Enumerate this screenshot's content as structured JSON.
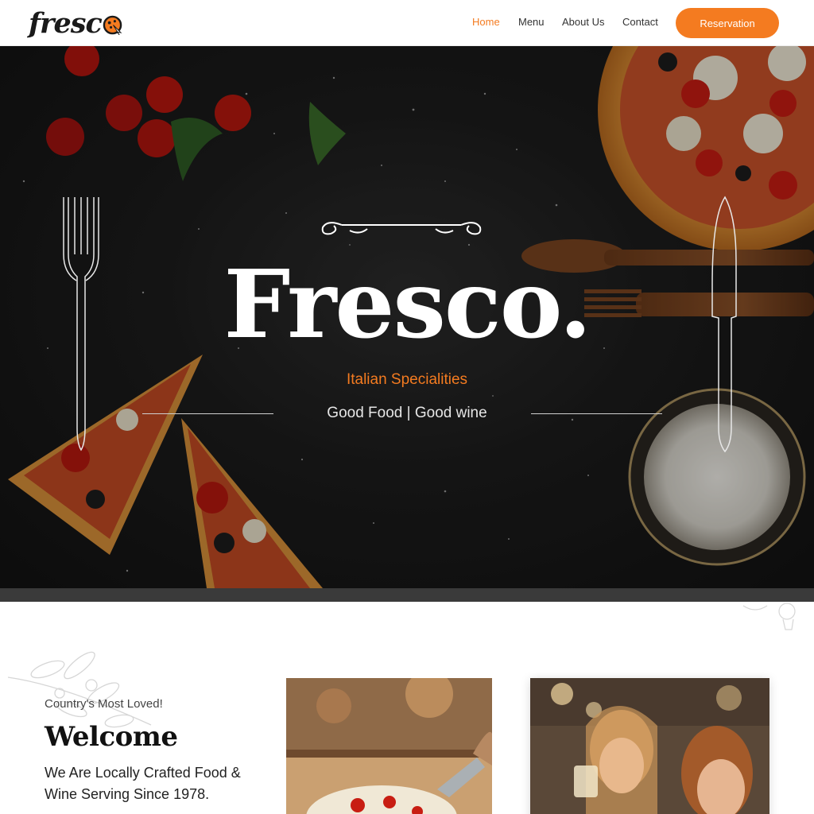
{
  "header": {
    "logo_text": "fresc",
    "nav": [
      {
        "label": "Home",
        "active": true
      },
      {
        "label": "Menu",
        "active": false
      },
      {
        "label": "About Us",
        "active": false
      },
      {
        "label": "Contact",
        "active": false
      }
    ],
    "cta_label": "Reservation"
  },
  "hero": {
    "title": "Fresco.",
    "subtitle": "Italian Specialities",
    "tagline": "Good Food | Good wine"
  },
  "welcome": {
    "kicker": "Country's Most Loved!",
    "title": "Welcome",
    "text": "We Are Locally Crafted Food & Wine Serving Since 1978."
  },
  "icons": [
    "pizza-logo-icon",
    "fork-icon",
    "knife-icon",
    "ornament-divider-icon",
    "olive-branch-icon"
  ],
  "colors": {
    "accent": "#f47b20",
    "hero_background": "#1c1c1c",
    "text_dark": "#111111"
  }
}
